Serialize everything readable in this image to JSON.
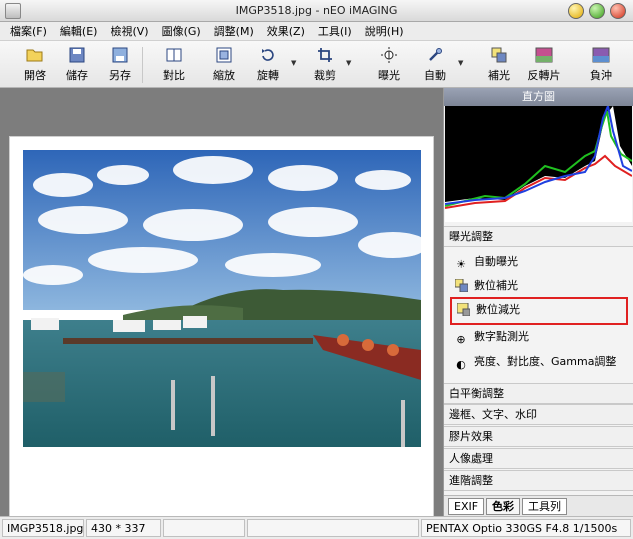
{
  "window": {
    "title": "IMGP3518.jpg - nEO iMAGING"
  },
  "menu": [
    "檔案(F)",
    "編輯(E)",
    "檢視(V)",
    "圖像(G)",
    "調整(M)",
    "效果(Z)",
    "工具(I)",
    "說明(H)"
  ],
  "toolbar": {
    "open": "開啓",
    "save": "儲存",
    "save_as": "另存",
    "compare": "對比",
    "zoom": "縮放",
    "rotate": "旋轉",
    "crop": "裁剪",
    "exposure": "曝光",
    "auto": "自動",
    "fill_light": "補光",
    "invert": "反轉片",
    "negative": "負沖"
  },
  "panel": {
    "histogram_title": "直方圖",
    "exposure_section": "曝光調整",
    "exposure_items": [
      "自動曝光",
      "數位補光",
      "數位減光",
      "數字點測光",
      "亮度、對比度、Gamma調整"
    ],
    "sections": [
      "白平衡調整",
      "邊框、文字、水印",
      "膠片效果",
      "人像處理",
      "進階調整"
    ],
    "tabs": [
      "EXIF",
      "色彩",
      "工具列"
    ]
  },
  "status": {
    "filename": "IMGP3518.jpg",
    "dimensions": "430 * 337",
    "camera": "PENTAX Optio 330GS F4.8 1/1500s"
  },
  "colors": {
    "accent_red": "#e02020",
    "panel_header": "#8a92a4",
    "workspace_bg": "#7d7d7d"
  },
  "icons": {
    "open": "folder-open-icon",
    "save": "save-disk-icon",
    "save_as": "save-as-icon",
    "compare": "compare-icon",
    "zoom": "zoom-icon",
    "rotate": "rotate-icon",
    "crop": "crop-icon",
    "exposure": "exposure-icon",
    "auto": "auto-wand-icon",
    "fill_light": "fill-light-icon",
    "invert": "invert-film-icon",
    "negative": "negative-icon"
  }
}
